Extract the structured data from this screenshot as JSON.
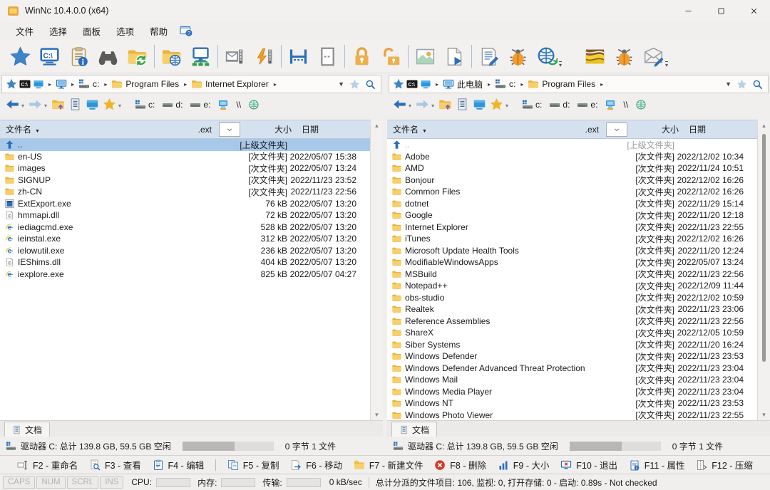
{
  "window": {
    "title": "WinNc 10.4.0.0 (x64)"
  },
  "colors": {
    "accent": "#2a6fba",
    "selection": "#a8c8e9",
    "folder": "#f0bc4a",
    "header": "#d5e1ee",
    "delete_red": "#d6382a",
    "lock_orange": "#eeb04c"
  },
  "menu": {
    "items": [
      {
        "label": "文件"
      },
      {
        "label": "选择"
      },
      {
        "label": "面板"
      },
      {
        "label": "选项"
      },
      {
        "label": "帮助"
      }
    ],
    "help_icon": "help-window"
  },
  "toolbar": {
    "items": [
      {
        "icon": "favorites-star"
      },
      {
        "icon": "command-prompt"
      },
      {
        "icon": "properties-clipboard"
      },
      {
        "icon": "search-binoculars"
      },
      {
        "icon": "folder-sync",
        "sep_after": true
      },
      {
        "icon": "folder-web"
      },
      {
        "icon": "network-computer",
        "sep_after": true
      },
      {
        "icon": "zip-mail"
      },
      {
        "icon": "zip-extract",
        "sep_after": true
      },
      {
        "icon": "split-horizontal"
      },
      {
        "icon": "single-panel",
        "sep_after": true
      },
      {
        "icon": "lock"
      },
      {
        "icon": "unlock",
        "sep_after": true
      },
      {
        "icon": "image-viewer"
      },
      {
        "icon": "file-play",
        "sep_after": true
      },
      {
        "icon": "file-edit"
      },
      {
        "icon": "debug-bug"
      },
      {
        "icon": "web-update",
        "dropdown": true,
        "gap_after": true
      },
      {
        "icon": "map-layers"
      },
      {
        "icon": "virus-bug"
      },
      {
        "icon": "mail-compose",
        "dropdown": true
      }
    ]
  },
  "panel_nav": {
    "items": [
      {
        "icon": "arrow-back",
        "caret": true
      },
      {
        "icon": "arrow-forward",
        "caret": true
      },
      {
        "icon": "folder-up"
      },
      {
        "icon": "file-list"
      },
      {
        "icon": "desktop-screen"
      },
      {
        "icon": "favorite-star-gold",
        "caret": true
      }
    ],
    "drives": [
      {
        "icon": "system-drive",
        "label": "c:"
      },
      {
        "icon": "hard-drive",
        "label": "d:"
      },
      {
        "icon": "hard-drive",
        "label": "e:"
      },
      {
        "icon": "network-drive"
      },
      {
        "label": "\\\\"
      },
      {
        "icon": "web-drive"
      }
    ]
  },
  "columns": {
    "name": "文件名",
    "ext": ".ext",
    "size": "大小",
    "date": "日期"
  },
  "panels": [
    {
      "breadcrumb": [
        {
          "icon": "pin-star"
        },
        {
          "icon": "terminal-badge"
        },
        {
          "icon": "desktop-screen",
          "arrow": true
        },
        {
          "icon": "computer-monitor",
          "arrow": true
        },
        {
          "icon": "system-drive",
          "label": "c:",
          "arrow": true
        },
        {
          "icon": "folder",
          "label": "Program Files",
          "arrow": true
        },
        {
          "icon": "folder",
          "label": "Internet Explorer",
          "arrow": true
        }
      ],
      "rows": [
        {
          "icon": "up-dir",
          "name": "..",
          "info": "[上级文件夹]",
          "date": "",
          "selected": true
        },
        {
          "icon": "folder",
          "name": "en-US",
          "info": "[次文件夹]",
          "date": "2022/05/07 15:38"
        },
        {
          "icon": "folder",
          "name": "images",
          "info": "[次文件夹]",
          "date": "2022/05/07 13:24"
        },
        {
          "icon": "folder",
          "name": "SIGNUP",
          "info": "[次文件夹]",
          "date": "2022/11/23 23:52"
        },
        {
          "icon": "folder",
          "name": "zh-CN",
          "info": "[次文件夹]",
          "date": "2022/11/23 22:56"
        },
        {
          "icon": "app-window",
          "name": "ExtExport.exe",
          "info": "76 kB",
          "date": "2022/05/07 13:20"
        },
        {
          "icon": "dll-file",
          "name": "hmmapi.dll",
          "info": "72 kB",
          "date": "2022/05/07 13:20"
        },
        {
          "icon": "ie-logo",
          "name": "iediagcmd.exe",
          "info": "528 kB",
          "date": "2022/05/07 13:20"
        },
        {
          "icon": "ie-logo",
          "name": "ieinstal.exe",
          "info": "312 kB",
          "date": "2022/05/07 13:20"
        },
        {
          "icon": "ie-logo",
          "name": "ielowutil.exe",
          "info": "236 kB",
          "date": "2022/05/07 13:20"
        },
        {
          "icon": "dll-file",
          "name": "IEShims.dll",
          "info": "404 kB",
          "date": "2022/05/07 13:20"
        },
        {
          "icon": "ie-logo",
          "name": "iexplore.exe",
          "info": "825 kB",
          "date": "2022/05/07 04:27"
        }
      ],
      "tab_label": "文档",
      "drive_info": {
        "label": "驱动器 C: 总计 139.8 GB, 59.5 GB 空闲",
        "used_percent": 57,
        "files_label": "0 字节 1 文件"
      }
    },
    {
      "breadcrumb": [
        {
          "icon": "pin-star"
        },
        {
          "icon": "terminal-badge"
        },
        {
          "icon": "desktop-screen",
          "arrow": true
        },
        {
          "icon": "computer-monitor",
          "label": "此电脑",
          "arrow": true
        },
        {
          "icon": "system-drive",
          "label": "c:",
          "arrow": true
        },
        {
          "icon": "folder",
          "label": "Program Files",
          "arrow": true
        }
      ],
      "rows": [
        {
          "icon": "up-dir",
          "name": "..",
          "info": "[上级文件夹]",
          "date": "",
          "dim": true
        },
        {
          "icon": "folder",
          "name": "Adobe",
          "info": "[次文件夹]",
          "date": "2022/12/02 10:34"
        },
        {
          "icon": "folder",
          "name": "AMD",
          "info": "[次文件夹]",
          "date": "2022/11/24 10:51"
        },
        {
          "icon": "folder",
          "name": "Bonjour",
          "info": "[次文件夹]",
          "date": "2022/12/02 16:26"
        },
        {
          "icon": "folder",
          "name": "Common Files",
          "info": "[次文件夹]",
          "date": "2022/12/02 16:26"
        },
        {
          "icon": "folder",
          "name": "dotnet",
          "info": "[次文件夹]",
          "date": "2022/11/29 15:14"
        },
        {
          "icon": "folder",
          "name": "Google",
          "info": "[次文件夹]",
          "date": "2022/11/20 12:18"
        },
        {
          "icon": "folder",
          "name": "Internet Explorer",
          "info": "[次文件夹]",
          "date": "2022/11/23 22:55"
        },
        {
          "icon": "folder",
          "name": "iTunes",
          "info": "[次文件夹]",
          "date": "2022/12/02 16:26"
        },
        {
          "icon": "folder",
          "name": "Microsoft Update Health Tools",
          "info": "[次文件夹]",
          "date": "2022/11/20 12:24"
        },
        {
          "icon": "folder",
          "name": "ModifiableWindowsApps",
          "info": "[次文件夹]",
          "date": "2022/05/07 13:24"
        },
        {
          "icon": "folder",
          "name": "MSBuild",
          "info": "[次文件夹]",
          "date": "2022/11/23 22:56"
        },
        {
          "icon": "folder",
          "name": "Notepad++",
          "info": "[次文件夹]",
          "date": "2022/12/09 11:44"
        },
        {
          "icon": "folder",
          "name": "obs-studio",
          "info": "[次文件夹]",
          "date": "2022/12/02 10:59"
        },
        {
          "icon": "folder",
          "name": "Realtek",
          "info": "[次文件夹]",
          "date": "2022/11/23 23:06"
        },
        {
          "icon": "folder",
          "name": "Reference Assemblies",
          "info": "[次文件夹]",
          "date": "2022/11/23 22:56"
        },
        {
          "icon": "folder",
          "name": "ShareX",
          "info": "[次文件夹]",
          "date": "2022/12/05 10:59"
        },
        {
          "icon": "folder",
          "name": "Siber Systems",
          "info": "[次文件夹]",
          "date": "2022/11/20 16:24"
        },
        {
          "icon": "folder",
          "name": "Windows Defender",
          "info": "[次文件夹]",
          "date": "2022/11/23 23:53"
        },
        {
          "icon": "folder",
          "name": "Windows Defender Advanced Threat Protection",
          "info": "[次文件夹]",
          "date": "2022/11/23 23:04"
        },
        {
          "icon": "folder",
          "name": "Windows Mail",
          "info": "[次文件夹]",
          "date": "2022/11/23 23:04"
        },
        {
          "icon": "folder",
          "name": "Windows Media Player",
          "info": "[次文件夹]",
          "date": "2022/11/23 23:04"
        },
        {
          "icon": "folder",
          "name": "Windows NT",
          "info": "[次文件夹]",
          "date": "2022/11/23 23:53"
        },
        {
          "icon": "folder",
          "name": "Windows Photo Viewer",
          "info": "[次文件夹]",
          "date": "2022/11/23 22:55"
        }
      ],
      "tab_label": "文档",
      "drive_info": {
        "label": "驱动器 C: 总计 139.8 GB, 59.5 GB 空闲",
        "used_percent": 57,
        "files_label": "0 字节 1 文件"
      }
    }
  ],
  "function_keys": [
    {
      "icon": "rename",
      "label": "F2 - 重命名"
    },
    {
      "icon": "view",
      "label": "F3 - 查看"
    },
    {
      "icon": "edit-clipboard",
      "label": "F4 - 编辑"
    },
    {
      "icon": "copy",
      "label": "F5 - 复制",
      "sep_before": true
    },
    {
      "icon": "move",
      "label": "F6 - 移动"
    },
    {
      "icon": "new-file",
      "label": "F7 - 新建文件"
    },
    {
      "icon": "delete",
      "label": "F8 - 删除"
    },
    {
      "icon": "size-chart",
      "label": "F9 - 大小"
    },
    {
      "icon": "exit",
      "label": "F10 - 退出"
    },
    {
      "icon": "properties",
      "label": "F11 - 属性"
    },
    {
      "icon": "compress",
      "label": "F12 - 压缩"
    }
  ],
  "status": {
    "locks": [
      "CAPS",
      "NUM",
      "SCRL",
      "INS"
    ],
    "meters": [
      {
        "label": "CPU:"
      },
      {
        "label": "内存:"
      },
      {
        "label": "传输:"
      }
    ],
    "speed": "0 kB/sec",
    "message": "总计分派的文件项目: 106, 监视: 0, 打开存储: 0 - 启动: 0.89s - Not checked"
  }
}
